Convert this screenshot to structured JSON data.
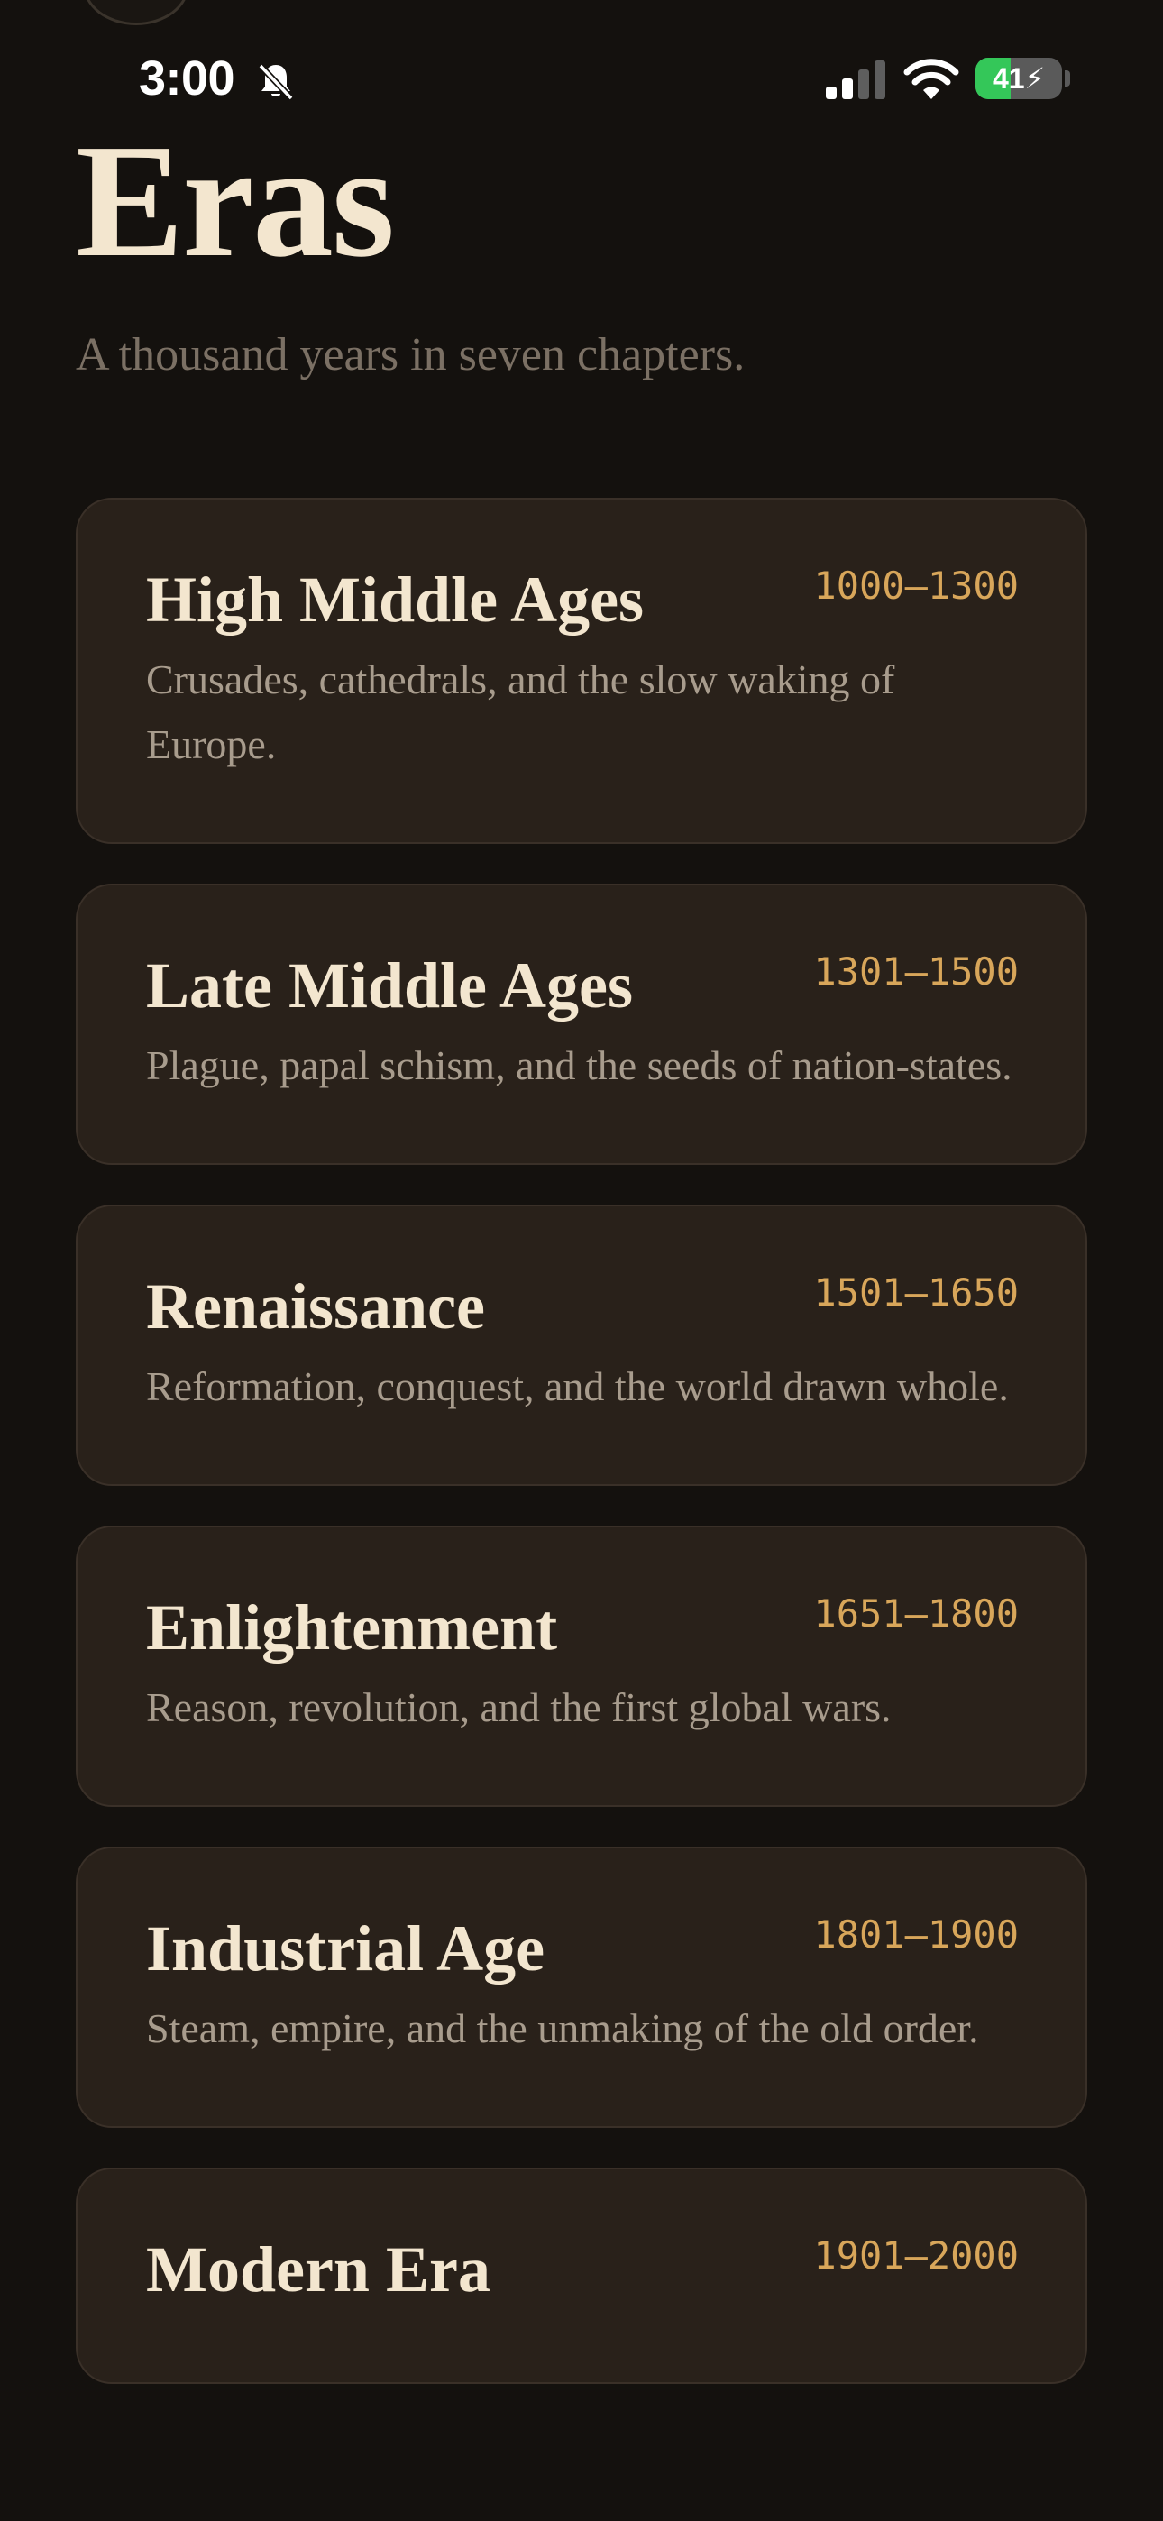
{
  "status_bar": {
    "time": "3:00",
    "battery_level": "41",
    "battery_fraction": 0.41,
    "battery_color": "#34c759",
    "icons": [
      "bell-slash-icon",
      "cellular-signal-icon",
      "wifi-icon",
      "battery-charging-icon"
    ]
  },
  "header": {
    "title": "Eras",
    "subtitle": "A thousand years in seven chapters."
  },
  "colors": {
    "background": "#14110e",
    "card": "#29211a",
    "accent": "#d8a65a",
    "title": "#f3e6cf"
  },
  "eras": [
    {
      "title": "High Middle Ages",
      "range": "1000–1300",
      "description": "Crusades, cathedrals, and the slow waking of Europe."
    },
    {
      "title": "Late Middle Ages",
      "range": "1301–1500",
      "description": "Plague, papal schism, and the seeds of nation-states."
    },
    {
      "title": "Renaissance",
      "range": "1501–1650",
      "description": "Reformation, conquest, and the world drawn whole."
    },
    {
      "title": "Enlightenment",
      "range": "1651–1800",
      "description": "Reason, revolution, and the first global wars."
    },
    {
      "title": "Industrial Age",
      "range": "1801–1900",
      "description": "Steam, empire, and the unmaking of the old order."
    },
    {
      "title": "Modern Era",
      "range": "1901–2000",
      "description": ""
    }
  ]
}
